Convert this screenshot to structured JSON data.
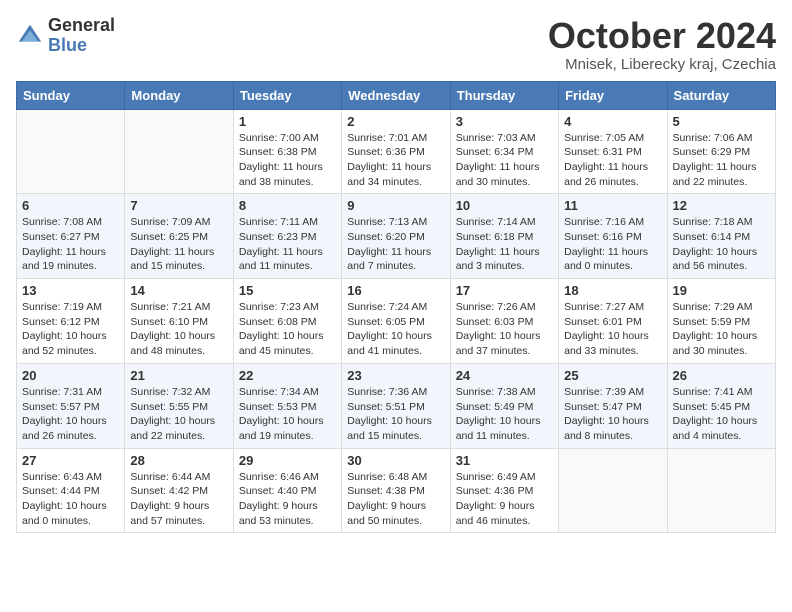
{
  "logo": {
    "general": "General",
    "blue": "Blue"
  },
  "title": "October 2024",
  "location": "Mnisek, Liberecky kraj, Czechia",
  "days_of_week": [
    "Sunday",
    "Monday",
    "Tuesday",
    "Wednesday",
    "Thursday",
    "Friday",
    "Saturday"
  ],
  "weeks": [
    [
      {
        "day": "",
        "info": ""
      },
      {
        "day": "",
        "info": ""
      },
      {
        "day": "1",
        "info": "Sunrise: 7:00 AM\nSunset: 6:38 PM\nDaylight: 11 hours and 38 minutes."
      },
      {
        "day": "2",
        "info": "Sunrise: 7:01 AM\nSunset: 6:36 PM\nDaylight: 11 hours and 34 minutes."
      },
      {
        "day": "3",
        "info": "Sunrise: 7:03 AM\nSunset: 6:34 PM\nDaylight: 11 hours and 30 minutes."
      },
      {
        "day": "4",
        "info": "Sunrise: 7:05 AM\nSunset: 6:31 PM\nDaylight: 11 hours and 26 minutes."
      },
      {
        "day": "5",
        "info": "Sunrise: 7:06 AM\nSunset: 6:29 PM\nDaylight: 11 hours and 22 minutes."
      }
    ],
    [
      {
        "day": "6",
        "info": "Sunrise: 7:08 AM\nSunset: 6:27 PM\nDaylight: 11 hours and 19 minutes."
      },
      {
        "day": "7",
        "info": "Sunrise: 7:09 AM\nSunset: 6:25 PM\nDaylight: 11 hours and 15 minutes."
      },
      {
        "day": "8",
        "info": "Sunrise: 7:11 AM\nSunset: 6:23 PM\nDaylight: 11 hours and 11 minutes."
      },
      {
        "day": "9",
        "info": "Sunrise: 7:13 AM\nSunset: 6:20 PM\nDaylight: 11 hours and 7 minutes."
      },
      {
        "day": "10",
        "info": "Sunrise: 7:14 AM\nSunset: 6:18 PM\nDaylight: 11 hours and 3 minutes."
      },
      {
        "day": "11",
        "info": "Sunrise: 7:16 AM\nSunset: 6:16 PM\nDaylight: 11 hours and 0 minutes."
      },
      {
        "day": "12",
        "info": "Sunrise: 7:18 AM\nSunset: 6:14 PM\nDaylight: 10 hours and 56 minutes."
      }
    ],
    [
      {
        "day": "13",
        "info": "Sunrise: 7:19 AM\nSunset: 6:12 PM\nDaylight: 10 hours and 52 minutes."
      },
      {
        "day": "14",
        "info": "Sunrise: 7:21 AM\nSunset: 6:10 PM\nDaylight: 10 hours and 48 minutes."
      },
      {
        "day": "15",
        "info": "Sunrise: 7:23 AM\nSunset: 6:08 PM\nDaylight: 10 hours and 45 minutes."
      },
      {
        "day": "16",
        "info": "Sunrise: 7:24 AM\nSunset: 6:05 PM\nDaylight: 10 hours and 41 minutes."
      },
      {
        "day": "17",
        "info": "Sunrise: 7:26 AM\nSunset: 6:03 PM\nDaylight: 10 hours and 37 minutes."
      },
      {
        "day": "18",
        "info": "Sunrise: 7:27 AM\nSunset: 6:01 PM\nDaylight: 10 hours and 33 minutes."
      },
      {
        "day": "19",
        "info": "Sunrise: 7:29 AM\nSunset: 5:59 PM\nDaylight: 10 hours and 30 minutes."
      }
    ],
    [
      {
        "day": "20",
        "info": "Sunrise: 7:31 AM\nSunset: 5:57 PM\nDaylight: 10 hours and 26 minutes."
      },
      {
        "day": "21",
        "info": "Sunrise: 7:32 AM\nSunset: 5:55 PM\nDaylight: 10 hours and 22 minutes."
      },
      {
        "day": "22",
        "info": "Sunrise: 7:34 AM\nSunset: 5:53 PM\nDaylight: 10 hours and 19 minutes."
      },
      {
        "day": "23",
        "info": "Sunrise: 7:36 AM\nSunset: 5:51 PM\nDaylight: 10 hours and 15 minutes."
      },
      {
        "day": "24",
        "info": "Sunrise: 7:38 AM\nSunset: 5:49 PM\nDaylight: 10 hours and 11 minutes."
      },
      {
        "day": "25",
        "info": "Sunrise: 7:39 AM\nSunset: 5:47 PM\nDaylight: 10 hours and 8 minutes."
      },
      {
        "day": "26",
        "info": "Sunrise: 7:41 AM\nSunset: 5:45 PM\nDaylight: 10 hours and 4 minutes."
      }
    ],
    [
      {
        "day": "27",
        "info": "Sunrise: 6:43 AM\nSunset: 4:44 PM\nDaylight: 10 hours and 0 minutes."
      },
      {
        "day": "28",
        "info": "Sunrise: 6:44 AM\nSunset: 4:42 PM\nDaylight: 9 hours and 57 minutes."
      },
      {
        "day": "29",
        "info": "Sunrise: 6:46 AM\nSunset: 4:40 PM\nDaylight: 9 hours and 53 minutes."
      },
      {
        "day": "30",
        "info": "Sunrise: 6:48 AM\nSunset: 4:38 PM\nDaylight: 9 hours and 50 minutes."
      },
      {
        "day": "31",
        "info": "Sunrise: 6:49 AM\nSunset: 4:36 PM\nDaylight: 9 hours and 46 minutes."
      },
      {
        "day": "",
        "info": ""
      },
      {
        "day": "",
        "info": ""
      }
    ]
  ]
}
